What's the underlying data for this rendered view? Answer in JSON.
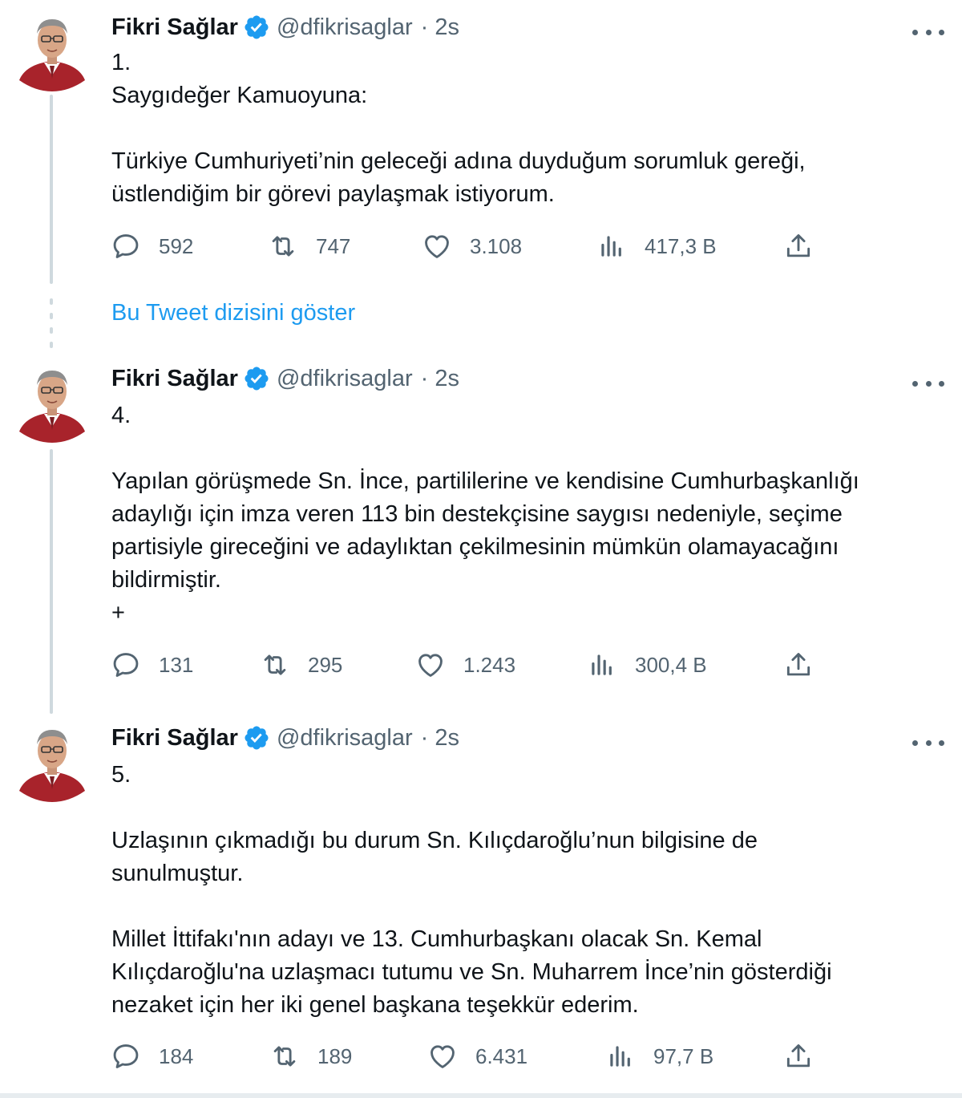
{
  "tweets": [
    {
      "name": "Fikri Sağlar",
      "handle": "@dfikrisaglar",
      "time": "· 2s",
      "text": "1.\nSaygıdeğer Kamuoyuna:\n\nTürkiye Cumhuriyeti’nin geleceği adına duyduğum sorumluk gereği,\nüstlendiğim bir görevi paylaşmak istiyorum.",
      "replies": "592",
      "retweets": "747",
      "likes": "3.108",
      "views": "417,3 B"
    },
    {
      "name": "Fikri Sağlar",
      "handle": "@dfikrisaglar",
      "time": "· 2s",
      "text": "4.\n\nYapılan görüşmede Sn. İnce, partililerine ve kendisine Cumhurbaşkanlığı\nadaylığı için imza veren 113 bin destekçisine saygısı nedeniyle, seçime\npartisiyle gireceğini ve adaylıktan çekilmesinin mümkün olamayacağını\nbildirmiştir.\n+",
      "replies": "131",
      "retweets": "295",
      "likes": "1.243",
      "views": "300,4 B"
    },
    {
      "name": "Fikri Sağlar",
      "handle": "@dfikrisaglar",
      "time": "· 2s",
      "text": "5.\n\nUzlaşının çıkmadığı bu durum Sn. Kılıçdaroğlu’nun bilgisine de\nsunulmuştur.\n\nMillet İttifakı'nın adayı ve 13. Cumhurbaşkanı olacak Sn. Kemal\nKılıçdaroğlu'na uzlaşmacı tutumu ve Sn. Muharrem İnce’nin gösterdiği\nnezaket için her iki genel başkana teşekkür ederim.",
      "replies": "184",
      "retweets": "189",
      "likes": "6.431",
      "views": "97,7 B"
    }
  ],
  "show_thread_label": "Bu Tweet dizisini göster",
  "colors": {
    "accent": "#1d9bf0",
    "text": "#0f1419",
    "secondary": "#536471",
    "thread_line": "#cfd9de"
  },
  "icons": [
    "reply-icon",
    "retweet-icon",
    "like-icon",
    "views-icon",
    "share-icon",
    "verified-badge-icon",
    "more-icon"
  ]
}
